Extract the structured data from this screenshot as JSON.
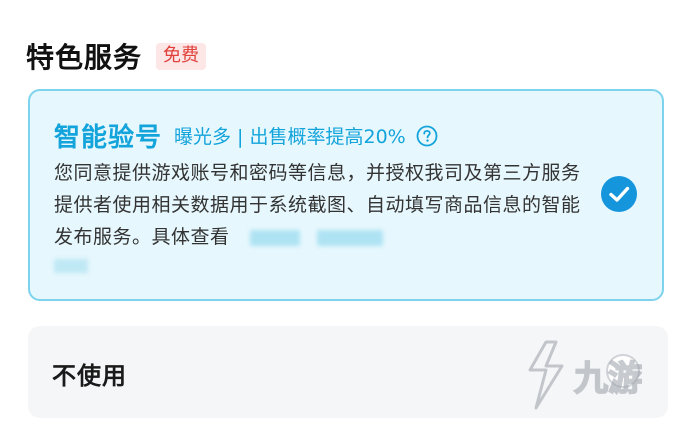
{
  "section": {
    "title": "特色服务",
    "badge": "免费"
  },
  "options": {
    "smart": {
      "title": "智能验号",
      "subtitle": "曝光多 | 出售概率提高20%",
      "description": "您同意提供游戏账号和密码等信息，并授权我司及第三方服务提供者使用相关数据用于系统截图、自动填写商品信息的智能发布服务。具体查看",
      "selected": true,
      "help_icon": "question-circle-icon",
      "check_icon": "check-circle-icon"
    },
    "none": {
      "label": "不使用",
      "selected": false,
      "radio_icon": "radio-unchecked-icon"
    }
  },
  "colors": {
    "accent": "#14a4dc",
    "card_bg": "#e6f7fd",
    "card_border": "#7dd3ee",
    "badge_bg": "#fde6e6",
    "badge_text": "#e0413a",
    "check": "#1495dc",
    "off_bg": "#f5f6f8"
  },
  "watermark": {
    "text": "九游",
    "icon": "watermark-logo-icon"
  }
}
